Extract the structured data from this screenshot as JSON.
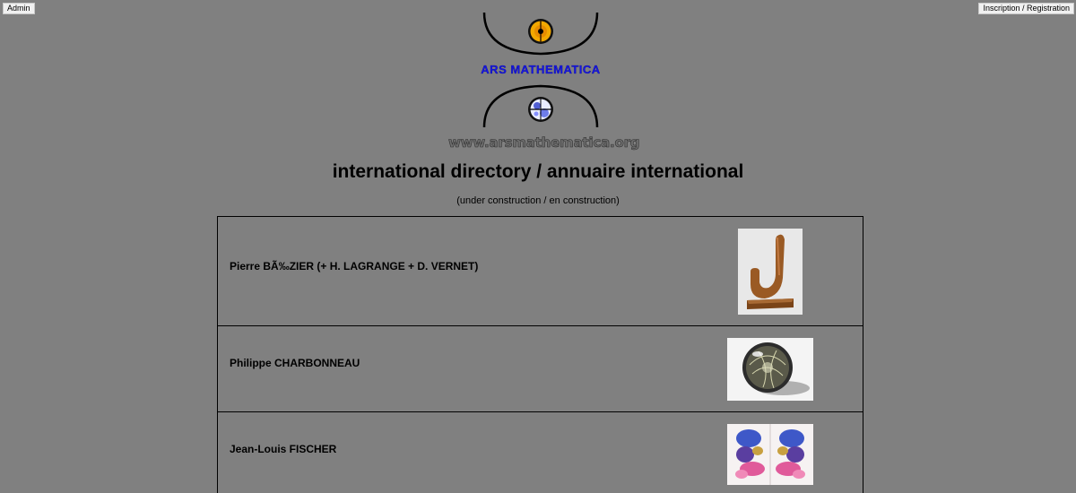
{
  "header": {
    "admin_label": "Admin",
    "registration_label": "Inscription / Registration"
  },
  "logo": {
    "title": "ARS MATHEMATICA",
    "url": "www.arsmathematica.org"
  },
  "page": {
    "title": "international directory / annuaire international",
    "subtitle": "(under construction / en construction)"
  },
  "directory": {
    "entries": [
      {
        "name": "Pierre BÃ‰ZIER (+ H. LAGRANGE + D. VERNET)",
        "image": "wooden-sculpture"
      },
      {
        "name": "Philippe CHARBONNEAU",
        "image": "glass-sphere"
      },
      {
        "name": "Jean-Louis FISCHER",
        "image": "symmetric-painting"
      }
    ]
  },
  "colors": {
    "background": "#808080",
    "logo_title": "#1616e6",
    "eye_top": "#f2a800",
    "eye_bottom": "#2a3cc8"
  }
}
